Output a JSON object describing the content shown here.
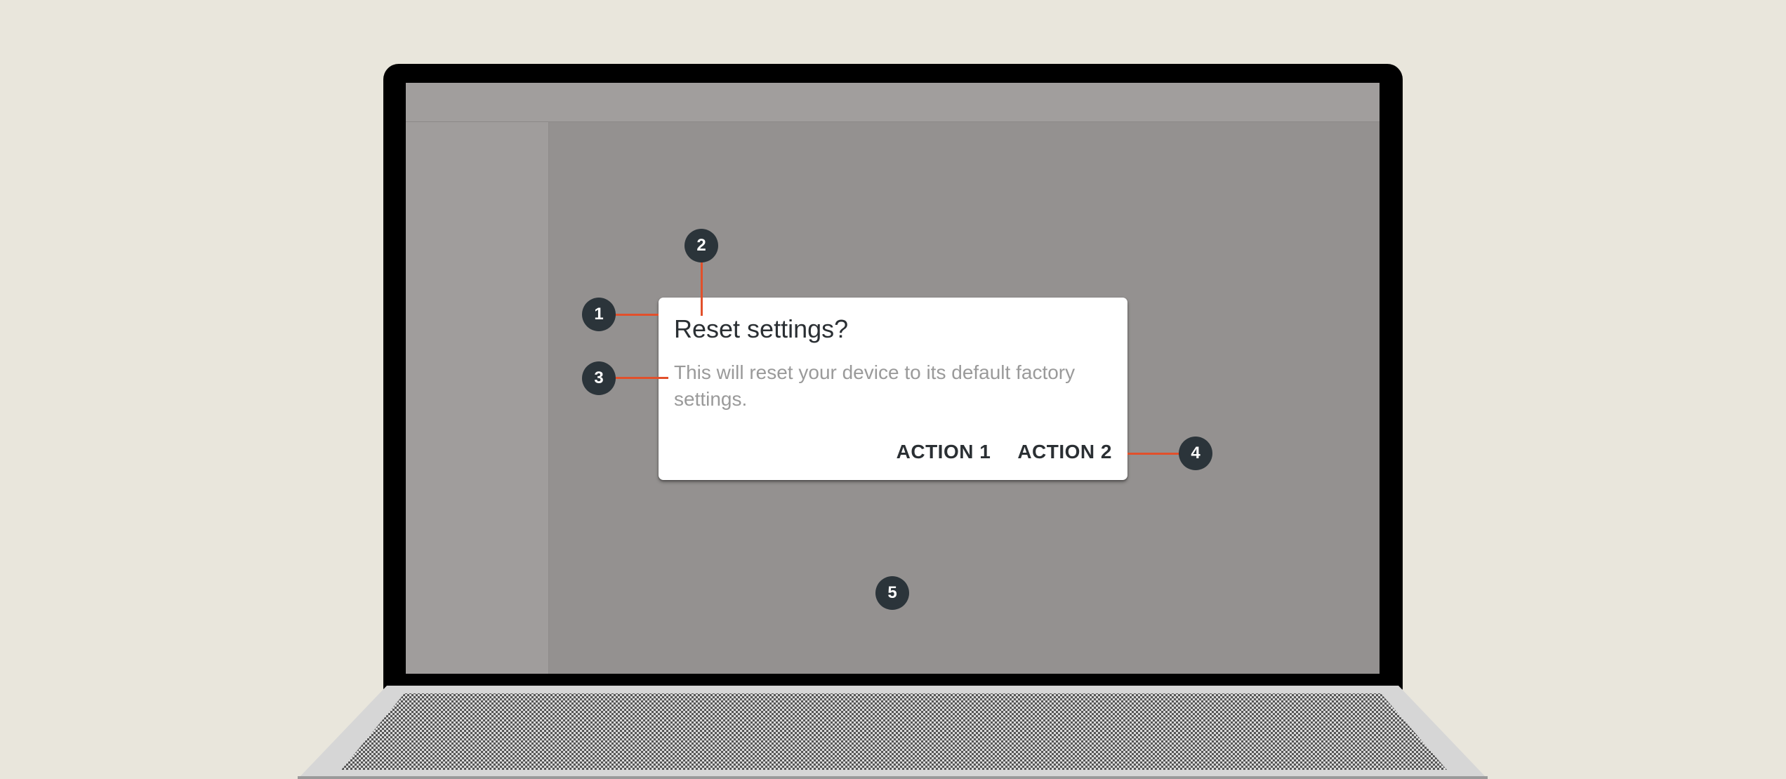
{
  "dialog": {
    "title": "Reset settings?",
    "body": "This will reset your device to its default factory settings.",
    "actions": [
      {
        "label": "ACTION 1"
      },
      {
        "label": "ACTION 2"
      }
    ]
  },
  "callouts": [
    {
      "label": "1",
      "target": "dialog-container"
    },
    {
      "label": "2",
      "target": "dialog-title"
    },
    {
      "label": "3",
      "target": "dialog-body"
    },
    {
      "label": "4",
      "target": "dialog-actions"
    },
    {
      "label": "5",
      "target": "scrim"
    }
  ],
  "colors": {
    "background": "#e9e6dc",
    "scrim": "#949190",
    "dialog_surface": "#ffffff",
    "marker": "#2b343a",
    "callout_line": "#e2502b",
    "title_text": "#2a2f33",
    "body_text": "#9a9a9a"
  }
}
